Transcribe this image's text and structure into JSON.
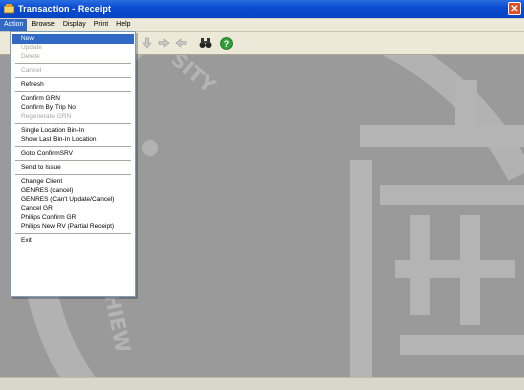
{
  "window": {
    "title": "Transaction - Receipt",
    "close_glyph": "✕"
  },
  "menubar": {
    "items": [
      "Action",
      "Browse",
      "Display",
      "Print",
      "Help"
    ],
    "active": "Action"
  },
  "toolbar": {
    "buttons": [
      "arrow-down-icon",
      "arrow-right-icon",
      "arrow-left-icon",
      "binoculars-icon",
      "help-icon"
    ]
  },
  "action_menu": {
    "items": [
      {
        "label": "New",
        "state": "highlighted"
      },
      {
        "label": "Update",
        "state": "disabled"
      },
      {
        "label": "Delete",
        "state": "disabled"
      },
      {
        "separator": true
      },
      {
        "label": "Cancel",
        "state": "disabled"
      },
      {
        "separator": true
      },
      {
        "label": "Refresh",
        "state": "enabled"
      },
      {
        "separator": true
      },
      {
        "label": "Confirm GRN",
        "state": "enabled"
      },
      {
        "label": "Confirm By Trip No",
        "state": "enabled"
      },
      {
        "label": "Regenerate GRN",
        "state": "disabled"
      },
      {
        "separator": true
      },
      {
        "label": "Single Location Bin-In",
        "state": "enabled"
      },
      {
        "label": "Show Last Bin-In Location",
        "state": "enabled"
      },
      {
        "separator": true
      },
      {
        "label": "Goto ConfirmSRV",
        "state": "enabled"
      },
      {
        "separator": true
      },
      {
        "label": "Send to Issue",
        "state": "enabled"
      },
      {
        "separator": true
      },
      {
        "label": "Change Client",
        "state": "enabled"
      },
      {
        "label": "GENRES (cancel)",
        "state": "enabled"
      },
      {
        "label": "GENRES (Can't Update/Cancel)",
        "state": "enabled"
      },
      {
        "label": "Cancel GR",
        "state": "enabled"
      },
      {
        "label": "Philips Confirm GR",
        "state": "enabled"
      },
      {
        "label": "Philips New RV (Partial Receipt)",
        "state": "enabled"
      },
      {
        "separator": true
      },
      {
        "label": "Exit",
        "state": "enabled"
      }
    ]
  },
  "watermark": {
    "left_text": "HUACHIEW",
    "top_text": "SITY",
    "glyph": "佛"
  }
}
